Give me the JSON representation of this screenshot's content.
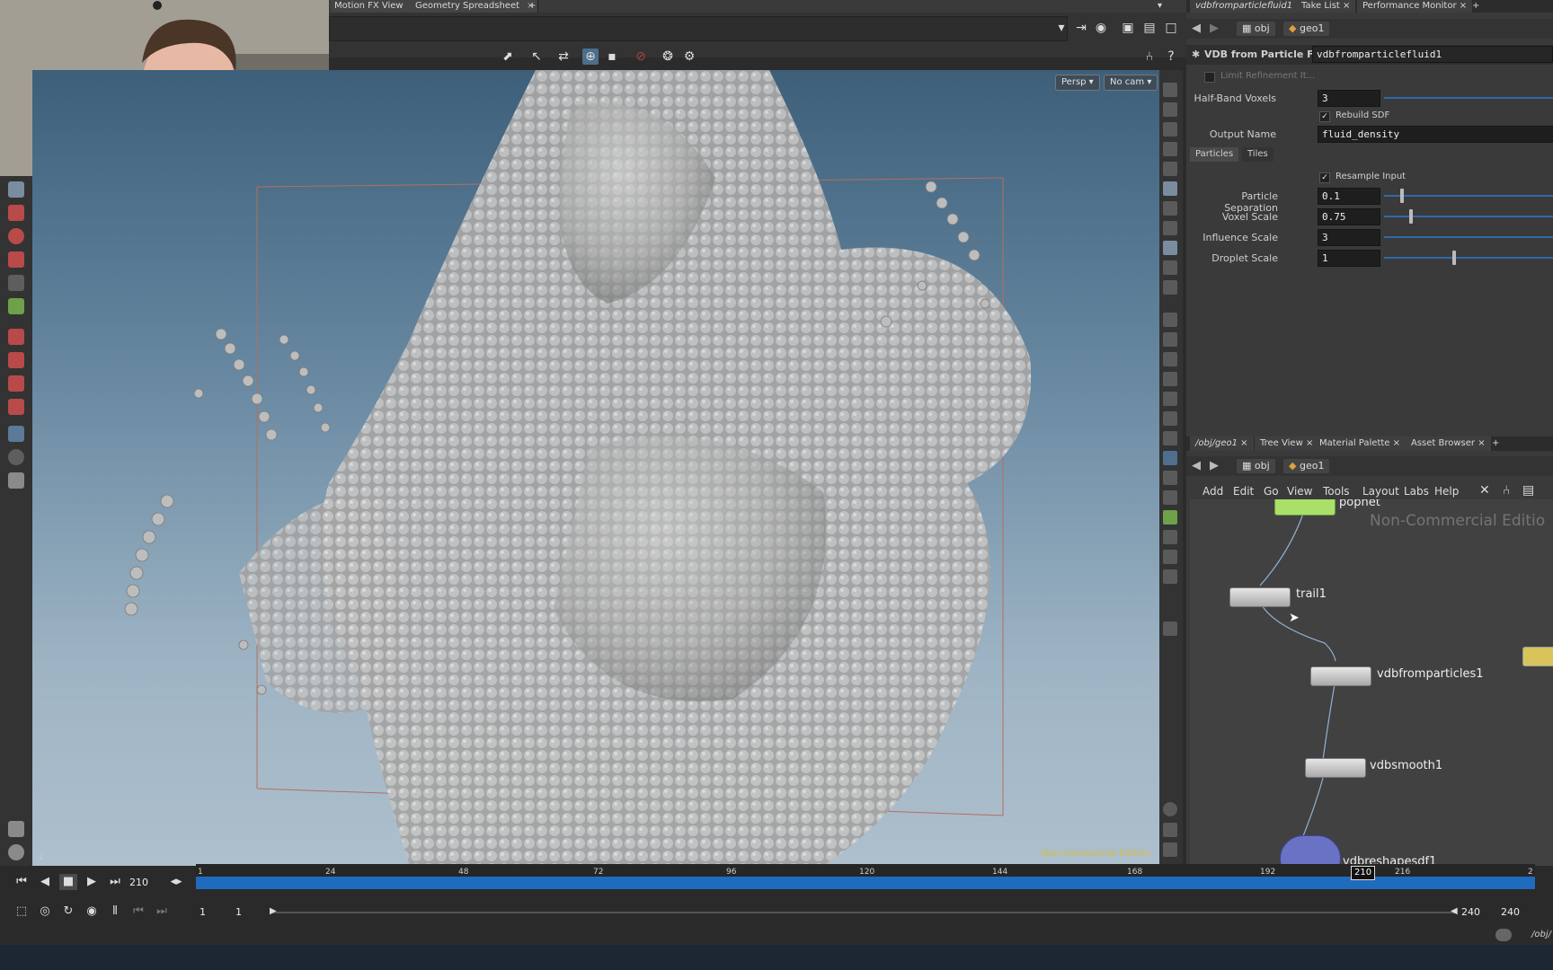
{
  "viewport_tabs": [
    {
      "label": "Motion FX View"
    },
    {
      "label": "Geometry Spreadsheet"
    }
  ],
  "viewport": {
    "persp_label": "Persp",
    "cam_label": "No cam",
    "watermark": "Non-Commercial Edition"
  },
  "param_tabs": [
    {
      "label": "vdbfromparticlefluid1"
    },
    {
      "label": "Take List"
    },
    {
      "label": "Performance Monitor"
    }
  ],
  "param_path": {
    "obj": "obj",
    "geo": "geo1"
  },
  "node_header": {
    "type": "VDB from Particle Fluid",
    "name": "vdbfromparticlefluid1"
  },
  "params": {
    "limit_refinement": "Limit Refinement It...",
    "half_band_label": "Half-Band Voxels",
    "half_band_value": "3",
    "rebuild_sdf_label": "Rebuild SDF",
    "output_name_label": "Output Name",
    "output_name_value": "fluid_density",
    "tabs": [
      "Particles",
      "Tiles"
    ],
    "resample_label": "Resample Input",
    "particle_sep_label": "Particle Separation",
    "particle_sep_value": "0.1",
    "voxel_scale_label": "Voxel Scale",
    "voxel_scale_value": "0.75",
    "influence_label": "Influence Scale",
    "influence_value": "3",
    "droplet_label": "Droplet Scale",
    "droplet_value": "1"
  },
  "net_tabs": [
    {
      "label": "/obj/geo1"
    },
    {
      "label": "Tree View"
    },
    {
      "label": "Material Palette"
    },
    {
      "label": "Asset Browser"
    }
  ],
  "net_path": {
    "obj": "obj",
    "geo": "geo1"
  },
  "net_menu": [
    "Add",
    "Edit",
    "Go",
    "View",
    "Tools",
    "Layout",
    "Labs",
    "Help"
  ],
  "net_watermark": "Non-Commercial Editio",
  "nodes": {
    "popnet": "popnet",
    "trail": "trail1",
    "vdbfromparticles": "vdbfromparticles1",
    "vdbsmooth": "vdbsmooth1",
    "partial": "vdbreshapesdf1"
  },
  "timeline": {
    "current_frame": "210",
    "marker": "210",
    "ticks": [
      "1",
      "24",
      "48",
      "72",
      "96",
      "120",
      "144",
      "168",
      "192",
      "216",
      "2"
    ],
    "start": "1",
    "start2": "1",
    "end": "240",
    "end2": "240"
  },
  "status": {
    "path": "/obj/"
  },
  "colors": {
    "timeline_blue": "#1f6bbd",
    "node_green": "#a8e06a",
    "watermark": "#d4c03a"
  }
}
